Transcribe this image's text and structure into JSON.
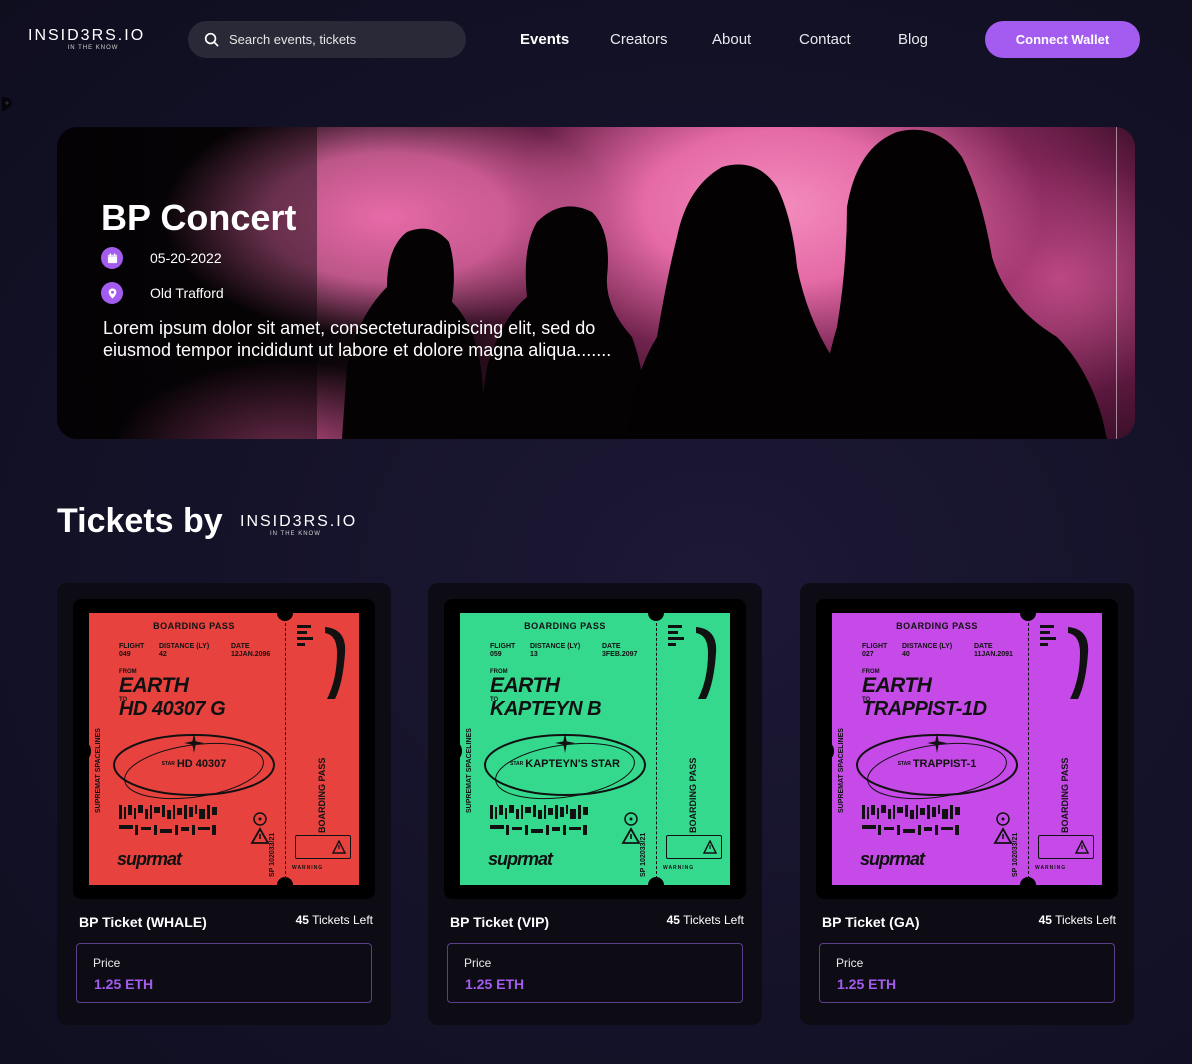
{
  "brand": {
    "name": "INSID3RS.IO",
    "tagline": "IN THE KNOW"
  },
  "search": {
    "placeholder": "Search events, tickets"
  },
  "nav": {
    "links": [
      {
        "label": "Events",
        "active": true
      },
      {
        "label": "Creators",
        "active": false
      },
      {
        "label": "About",
        "active": false
      },
      {
        "label": "Contact",
        "active": false
      },
      {
        "label": "Blog",
        "active": false
      }
    ],
    "connect_label": "Connect Wallet"
  },
  "hero": {
    "title": "BP Concert",
    "date": "05-20-2022",
    "venue": "Old Trafford",
    "description": "Lorem ipsum dolor sit amet, consecteturadipiscing elit, sed do eiusmod tempor incididunt ut labore et dolore magna aliqua.......",
    "date_icon": "calendar-icon",
    "venue_icon": "location-pin-icon"
  },
  "tickets_section": {
    "title": "Tickets by"
  },
  "tickets": [
    {
      "name": "BP Ticket (WHALE)",
      "left_count": "45",
      "left_label": "Tickets Left",
      "price_label": "Price",
      "price": "1.25 ETH",
      "color": "#e8423f",
      "pass": {
        "boarding": "BOARDING PASS",
        "flight_l": "FLIGHT",
        "flight": "049",
        "distance_l": "DISTANCE (LY)",
        "distance": "42",
        "date_l": "DATE",
        "date": "12JAN.2096",
        "from_l": "FROM",
        "from": "EARTH",
        "to_l": "TO",
        "to": "HD 40307 G",
        "star_l": "STAR",
        "star": "HD 40307",
        "line": "SUPREMAT SPACELINES",
        "sp": "SP 102033/21",
        "brand": "suprmat",
        "warning": "WARNING"
      }
    },
    {
      "name": "BP Ticket (VIP)",
      "left_count": "45",
      "left_label": "Tickets Left",
      "price_label": "Price",
      "price": "1.25 ETH",
      "color": "#34d98e",
      "pass": {
        "boarding": "BOARDING PASS",
        "flight_l": "FLIGHT",
        "flight": "059",
        "distance_l": "DISTANCE (LY)",
        "distance": "13",
        "date_l": "DATE",
        "date": "3FEB.2097",
        "from_l": "FROM",
        "from": "EARTH",
        "to_l": "TO",
        "to": "KAPTEYN B",
        "star_l": "STAR",
        "star": "KAPTEYN'S STAR",
        "line": "SUPREMAT SPACELINES",
        "sp": "SP 102033/21",
        "brand": "suprmat",
        "warning": "WARNING"
      }
    },
    {
      "name": "BP Ticket (GA)",
      "left_count": "45",
      "left_label": "Tickets Left",
      "price_label": "Price",
      "price": "1.25 ETH",
      "color": "#c54ae8",
      "pass": {
        "boarding": "BOARDING PASS",
        "flight_l": "FLIGHT",
        "flight": "027",
        "distance_l": "DISTANCE (LY)",
        "distance": "40",
        "date_l": "DATE",
        "date": "11JAN.2091",
        "from_l": "FROM",
        "from": "EARTH",
        "to_l": "TO",
        "to": "TRAPPIST-1D",
        "star_l": "STAR",
        "star": "TRAPPIST-1",
        "line": "SUPREMAT SPACELINES",
        "sp": "SP 102033/21",
        "brand": "suprmat",
        "warning": "WARNING"
      }
    }
  ],
  "colors": {
    "accent": "#a45cf0",
    "card_bg": "#0d0c14",
    "search_bg": "#2a2938"
  }
}
